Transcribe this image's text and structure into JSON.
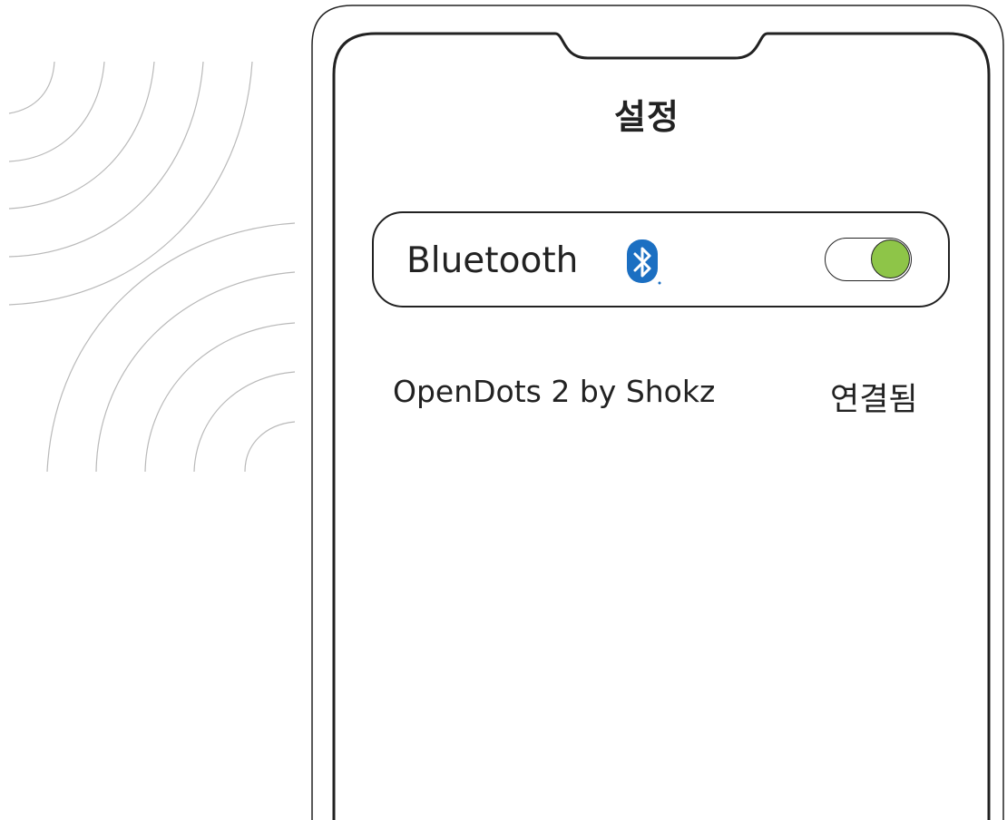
{
  "screen": {
    "title": "설정"
  },
  "bluetooth": {
    "label": "Bluetooth",
    "icon": "bluetooth-icon",
    "toggle_on": true,
    "toggle_color": "#8ec548",
    "icon_color": "#1b6fc2"
  },
  "devices": [
    {
      "name": "OpenDots 2 by Shokz",
      "status": "연결됨"
    }
  ]
}
